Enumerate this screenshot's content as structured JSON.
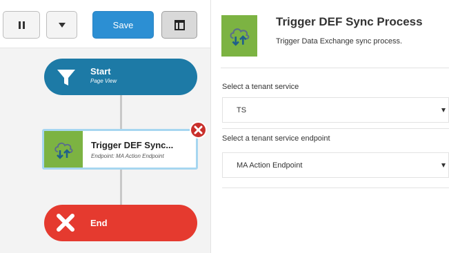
{
  "toolbar": {
    "pause_icon": "pause-icon",
    "dropdown_icon": "caret-down-icon",
    "save_label": "Save",
    "layout_icon": "panel-layout-icon"
  },
  "flow": {
    "start": {
      "title": "Start",
      "subtitle": "Page View",
      "icon": "funnel-icon",
      "color": "#1d7aa6"
    },
    "trigger": {
      "title": "Trigger DEF Sync...",
      "subtitle": "Endpoint: MA Action Endpoint",
      "icon": "cloud-sync-icon",
      "color": "#7cb342"
    },
    "end": {
      "title": "End",
      "icon": "close-icon",
      "color": "#e53a2f"
    }
  },
  "panel": {
    "title": "Trigger DEF Sync Process",
    "subtitle": "Trigger Data Exchange sync process.",
    "fields": [
      {
        "label": "Select a tenant service",
        "value": "TS"
      },
      {
        "label": "Select a tenant service endpoint",
        "value": "MA Action Endpoint"
      }
    ]
  },
  "colors": {
    "accent": "#2c8fd3",
    "start_node": "#1d7aa6",
    "end_node": "#e53a2f",
    "action_thumb": "#7cb342",
    "remove": "#c9302c"
  }
}
